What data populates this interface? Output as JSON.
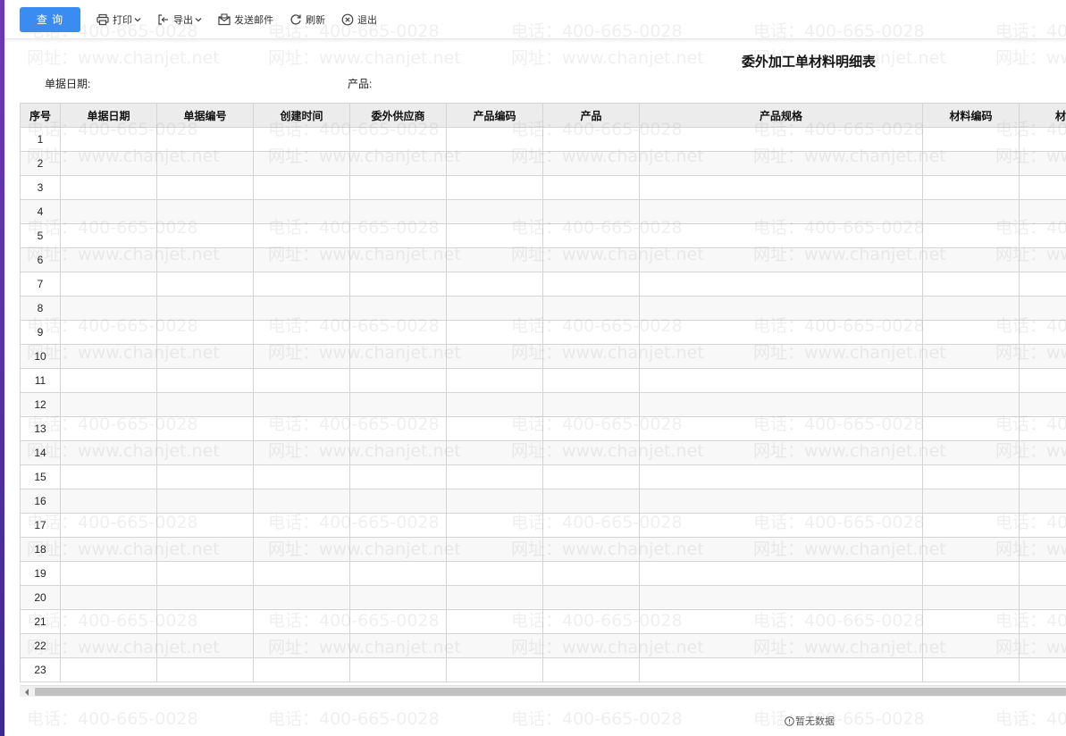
{
  "toolbar": {
    "query_label": "查 询",
    "print_label": "打印",
    "export_label": "导出",
    "email_label": "发送邮件",
    "refresh_label": "刷新",
    "exit_label": "退出"
  },
  "report": {
    "title": "委外加工单材料明细表",
    "filter_date_label": "单据日期:",
    "filter_product_label": "产品:"
  },
  "table": {
    "columns": [
      "序号",
      "单据日期",
      "单据编号",
      "创建时间",
      "委外供应商",
      "产品编码",
      "产品",
      "产品规格",
      "材料编码",
      "材"
    ],
    "row_numbers": [
      "1",
      "2",
      "3",
      "4",
      "5",
      "6",
      "7",
      "8",
      "9",
      "10",
      "11",
      "12",
      "13",
      "14",
      "15",
      "16",
      "17",
      "18",
      "19",
      "20",
      "21",
      "22",
      "23"
    ]
  },
  "status": {
    "no_data": "暂无数据"
  },
  "watermark": {
    "phone": "电话：400-665-0028",
    "site": "网址：www.chanjet.net"
  },
  "colors": {
    "primary": "#3b8cf0",
    "header_bg": "#ececec",
    "border": "#d4d4d4",
    "accent_left": "#5a34a0"
  }
}
